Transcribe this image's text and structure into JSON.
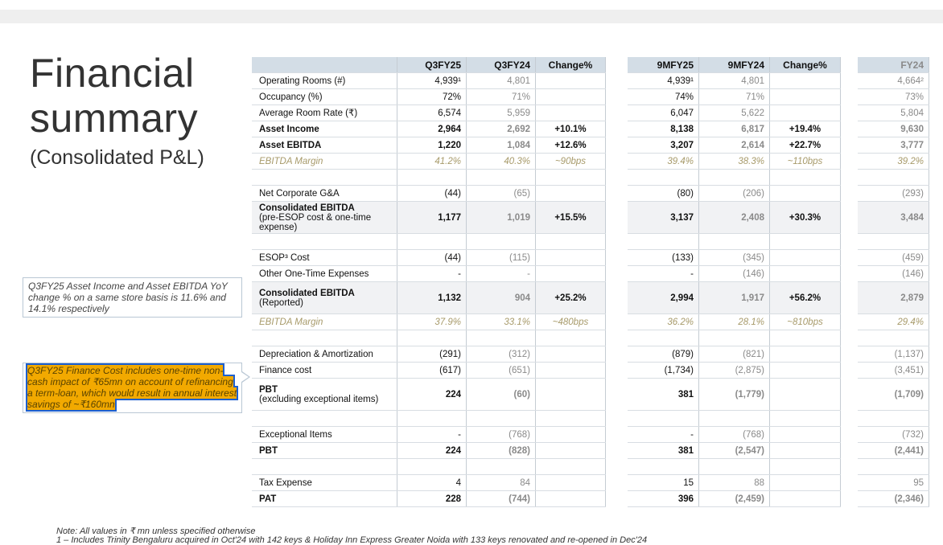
{
  "title": {
    "line1": "Financial",
    "line2": "summary",
    "line3": "(Consolidated P&L)"
  },
  "notes": {
    "note1": "Q3FY25 Asset Income and Asset EBITDA YoY change % on a same store basis is 11.6% and 14.1% respectively",
    "note2": "Q3FY25 Finance Cost includes one-time non-cash impact of ₹65mn on account of refinancing a term-loan, which would result in annual interest savings of ~₹160mn"
  },
  "headers": [
    "Q3FY25",
    "Q3FY24",
    "Change%",
    "9MFY25",
    "9MFY24",
    "Change%",
    "FY24"
  ],
  "rows": [
    {
      "label": "Operating Rooms (#)",
      "vals": [
        "4,939¹",
        "4,801",
        "",
        "4,939¹",
        "4,801",
        "",
        "4,664²"
      ]
    },
    {
      "label": "Occupancy (%)",
      "vals": [
        "72%",
        "71%",
        "",
        "74%",
        "71%",
        "",
        "73%"
      ]
    },
    {
      "label": "Average Room Rate (₹)",
      "vals": [
        "6,574",
        "5,959",
        "",
        "6,047",
        "5,622",
        "",
        "5,804"
      ]
    },
    {
      "label": "Asset Income",
      "vals": [
        "2,964",
        "2,692",
        "+10.1%",
        "8,138",
        "6,817",
        "+19.4%",
        "9,630"
      ]
    },
    {
      "label": "Asset EBITDA",
      "vals": [
        "1,220",
        "1,084",
        "+12.6%",
        "3,207",
        "2,614",
        "+22.7%",
        "3,777"
      ]
    },
    {
      "label": "EBITDA Margin",
      "vals": [
        "41.2%",
        "40.3%",
        "~90bps",
        "39.4%",
        "38.3%",
        "~110bps",
        "39.2%"
      ]
    },
    {
      "label": "",
      "vals": [
        "",
        "",
        "",
        "",
        "",
        "",
        ""
      ]
    },
    {
      "label": "Net Corporate G&A",
      "vals": [
        "(44)",
        "(65)",
        "",
        "(80)",
        "(206)",
        "",
        "(293)"
      ]
    },
    {
      "label_bold": "Consolidated EBITDA",
      "label": "(pre-ESOP cost & one-time expense)",
      "vals": [
        "1,177",
        "1,019",
        "+15.5%",
        "3,137",
        "2,408",
        "+30.3%",
        "3,484"
      ]
    },
    {
      "label": "",
      "vals": [
        "",
        "",
        "",
        "",
        "",
        "",
        ""
      ]
    },
    {
      "label": "ESOP³ Cost",
      "vals": [
        "(44)",
        "(115)",
        "",
        "(133)",
        "(345)",
        "",
        "(459)"
      ]
    },
    {
      "label": "Other One-Time Expenses",
      "vals": [
        "-",
        "-",
        "",
        "-",
        "(146)",
        "",
        "(146)"
      ]
    },
    {
      "label_bold": "Consolidated EBITDA",
      "label": "(Reported)",
      "vals": [
        "1,132",
        "904",
        "+25.2%",
        "2,994",
        "1,917",
        "+56.2%",
        "2,879"
      ]
    },
    {
      "label": "EBITDA Margin",
      "vals": [
        "37.9%",
        "33.1%",
        "~480bps",
        "36.2%",
        "28.1%",
        "~810bps",
        "29.4%"
      ]
    },
    {
      "label": "",
      "vals": [
        "",
        "",
        "",
        "",
        "",
        "",
        ""
      ]
    },
    {
      "label": "Depreciation & Amortization",
      "vals": [
        "(291)",
        "(312)",
        "",
        "(879)",
        "(821)",
        "",
        "(1,137)"
      ]
    },
    {
      "label": "Finance cost",
      "vals": [
        "(617)",
        "(651)",
        "",
        "(1,734)",
        "(2,875)",
        "",
        "(3,451)"
      ]
    },
    {
      "label_bold": "PBT",
      "label": "(excluding exceptional items)",
      "vals": [
        "224",
        "(60)",
        "",
        "381",
        "(1,779)",
        "",
        "(1,709)"
      ]
    },
    {
      "label": "",
      "vals": [
        "",
        "",
        "",
        "",
        "",
        "",
        ""
      ]
    },
    {
      "label": "Exceptional Items",
      "vals": [
        "-",
        "(768)",
        "",
        "-",
        "(768)",
        "",
        "(732)"
      ]
    },
    {
      "label": "PBT",
      "vals": [
        "224",
        "(828)",
        "",
        "381",
        "(2,547)",
        "",
        "(2,441)"
      ]
    },
    {
      "label": "",
      "vals": [
        "",
        "",
        "",
        "",
        "",
        "",
        ""
      ]
    },
    {
      "label": "Tax Expense",
      "vals": [
        "4",
        "84",
        "",
        "15",
        "88",
        "",
        "95"
      ]
    },
    {
      "label": "PAT",
      "vals": [
        "228",
        "(744)",
        "",
        "396",
        "(2,459)",
        "",
        "(2,346)"
      ]
    }
  ],
  "footnote": "Note: All values in ₹ mn unless specified otherwise",
  "footnote2": "1 – Includes Trinity Bengaluru acquired in Oct'24 with 142 keys & Holiday Inn Express Greater Noida with 133 keys renovated and re-opened in Dec'24"
}
